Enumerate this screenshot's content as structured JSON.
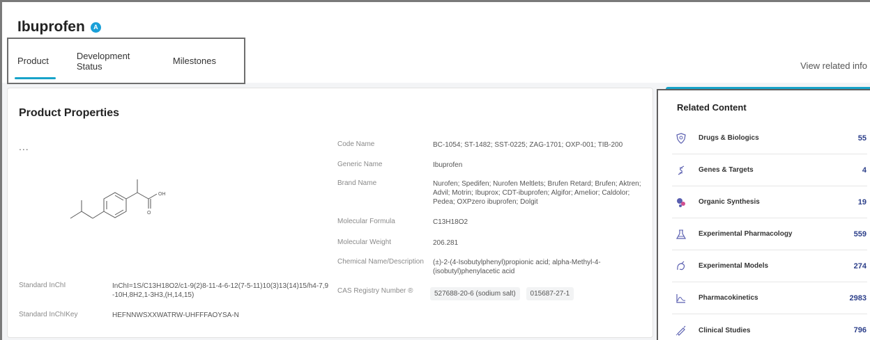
{
  "header": {
    "title": "Ibuprofen",
    "badge": "A",
    "tabs": [
      {
        "label": "Product"
      },
      {
        "label": "Development Status"
      },
      {
        "label": "Milestones"
      }
    ],
    "view_related": "View related info"
  },
  "properties": {
    "title": "Product Properties",
    "more": "...",
    "structure_labels": {
      "oh": "OH",
      "o": "O"
    },
    "inchi_label": "Standard InChI",
    "inchi_value_line1": "InChI=1S/C13H18O2/c1-9(2)8-11-4-6-12(7-5-11)10(3)13(14)15/h4-7,9",
    "inchi_value_line2": "-10H,8H2,1-3H3,(H,14,15)",
    "inchikey_label": "Standard InChIKey",
    "inchikey_value": "HEFNNWSXXWATRW-UHFFFAOYSA-N",
    "code_name_label": "Code Name",
    "code_name_value": "BC-1054; ST-1482; SST-0225; ZAG-1701; OXP-001; TIB-200",
    "generic_name_label": "Generic Name",
    "generic_name_value": "Ibuprofen",
    "brand_name_label": "Brand Name",
    "brand_name_line1": "Nurofen; Spedifen; Nurofen Meltlets; Brufen Retard; Brufen; Aktren;",
    "brand_name_line2": "Advil; Motrin; Ibuprox; CDT-ibuprofen; Algifor; Amelior; Caldolor;",
    "brand_name_line3": "Pedea; OXPzero ibuprofen; Dolgit",
    "formula_label": "Molecular Formula",
    "formula_value": "C13H18O2",
    "weight_label": "Molecular Weight",
    "weight_value": "206.281",
    "chem_name_label": "Chemical Name/Description",
    "chem_name_line1": "(±)-2-(4-Isobutylphenyl)propionic acid; alpha-Methyl-4-",
    "chem_name_line2": "(isobutyl)phenylacetic acid",
    "cas_label": "CAS Registry Number ®",
    "cas_values": [
      "527688-20-6 (sodium salt)",
      "015687-27-1"
    ]
  },
  "related": {
    "title": "Related Content",
    "accent": "#17a3c9",
    "count_color": "#2c3f8a",
    "items": [
      {
        "label": "Drugs & Biologics",
        "count": "55",
        "icon": "shield-drug-icon"
      },
      {
        "label": "Genes & Targets",
        "count": "4",
        "icon": "dna-icon"
      },
      {
        "label": "Organic Synthesis",
        "count": "19",
        "icon": "molecule-icon"
      },
      {
        "label": "Experimental Pharmacology",
        "count": "559",
        "icon": "flask-icon"
      },
      {
        "label": "Experimental Models",
        "count": "274",
        "icon": "model-icon"
      },
      {
        "label": "Pharmacokinetics",
        "count": "2983",
        "icon": "curve-chart-icon"
      },
      {
        "label": "Clinical Studies",
        "count": "796",
        "icon": "syringe-icon"
      }
    ]
  }
}
